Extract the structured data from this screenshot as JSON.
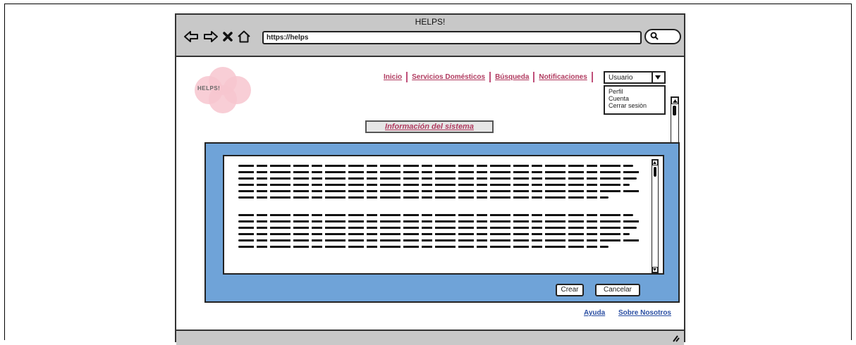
{
  "window": {
    "title": "HELPS!"
  },
  "browser": {
    "url": "https://helps"
  },
  "logo": {
    "text": "HELPS!"
  },
  "nav": {
    "items": [
      "Inicio",
      "Servicios Domésticos",
      "Búsqueda",
      "Notificaciones"
    ]
  },
  "user_menu": {
    "selected": "Usuario",
    "options": [
      "Perfil",
      "Cuenta",
      "Cerrar sesiòn"
    ]
  },
  "section": {
    "title": "Información del sistema"
  },
  "actions": {
    "create_label": "Crear",
    "cancel_label": "Cancelar"
  },
  "footer": {
    "help": "Ayuda",
    "about": "Sobre Nosotros"
  },
  "colors": {
    "panel": "#6fa3d8",
    "accent": "#b03a5f",
    "logo": "#f7c6cf",
    "chrome": "#c8c8c8"
  }
}
